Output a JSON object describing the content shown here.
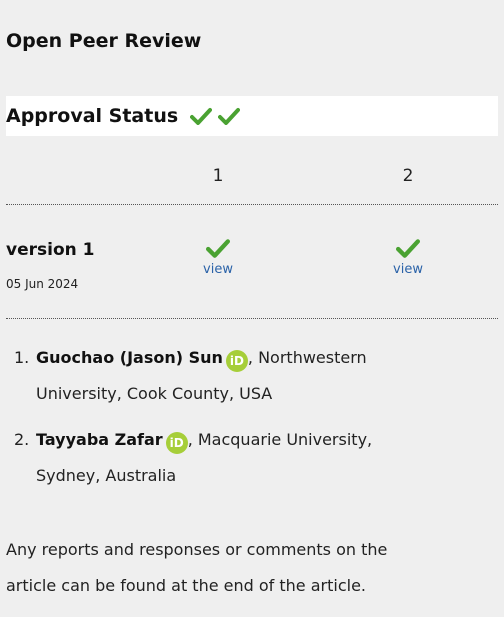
{
  "header": {
    "title": "Open Peer Review"
  },
  "approval": {
    "label": "Approval Status",
    "status_icons": [
      "check-approved-icon",
      "check-approved-icon"
    ],
    "check_color": "#4aa232"
  },
  "table": {
    "columns": [
      "1",
      "2"
    ],
    "versions": [
      {
        "label": "version 1",
        "date": "05 Jun 2024",
        "cells": [
          {
            "status_icon": "check-approved-icon",
            "link": "view"
          },
          {
            "status_icon": "check-approved-icon",
            "link": "view"
          }
        ]
      }
    ]
  },
  "reviewers": [
    {
      "number": "1.",
      "name": "Guochao (Jason) Sun",
      "affiliation_line1": ", Northwestern",
      "affiliation_line2": "University, Cook County, USA",
      "orcid_label": "iD"
    },
    {
      "number": "2.",
      "name": "Tayyaba Zafar",
      "affiliation_line1": ", Macquarie University,",
      "affiliation_line2": "Sydney, Australia",
      "orcid_label": "iD"
    }
  ],
  "footer": {
    "line1": "Any reports and responses or comments on the",
    "line2": "article can be found at the end of the article."
  },
  "colors": {
    "link": "#2a62a8",
    "orcid": "#a6ce39",
    "background": "#efefef"
  }
}
